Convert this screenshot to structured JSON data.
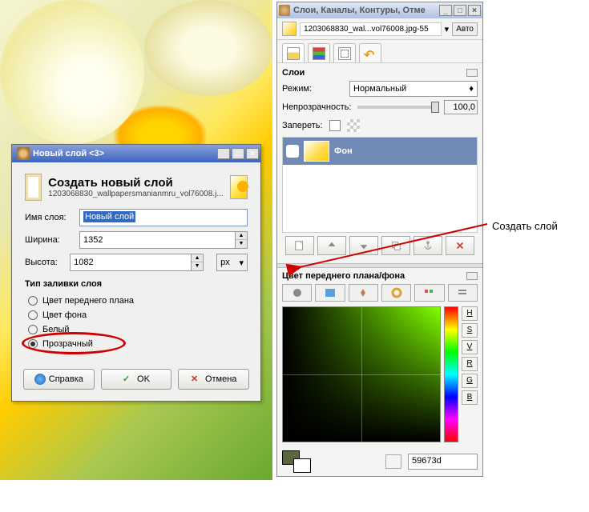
{
  "new_layer_dialog": {
    "title": "Новый слой <3>",
    "header": "Создать новый слой",
    "subheader": "1203068830_wallpapersmanianmru_vol76008.j...",
    "name_label": "Имя слоя:",
    "name_value": "Новый слой",
    "width_label": "Ширина:",
    "width_value": "1352",
    "height_label": "Высота:",
    "height_value": "1082",
    "units": "px",
    "fill_title": "Тип заливки слоя",
    "fill_options": {
      "fg": "Цвет переднего плана",
      "bg": "Цвет фона",
      "white": "Белый",
      "transparent": "Прозрачный"
    },
    "buttons": {
      "help": "Справка",
      "ok": "OK",
      "cancel": "Отмена"
    }
  },
  "dock": {
    "title": "Слои, Каналы, Контуры, Отме",
    "image_name": "1203068830_wal...vol76008.jpg-55",
    "auto": "Авто",
    "layers": {
      "title": "Слои",
      "mode_label": "Режим:",
      "mode_value": "Нормальный",
      "opacity_label": "Непрозрачность:",
      "opacity_value": "100,0",
      "lock_label": "Запереть:",
      "layer_name": "Фон"
    },
    "color": {
      "title": "Цвет переднего плана/фона",
      "channels": {
        "h": "H",
        "s": "S",
        "v": "V",
        "r": "R",
        "g": "G",
        "b": "B"
      },
      "hex": "59673d"
    }
  },
  "annotation": "Создать слой"
}
